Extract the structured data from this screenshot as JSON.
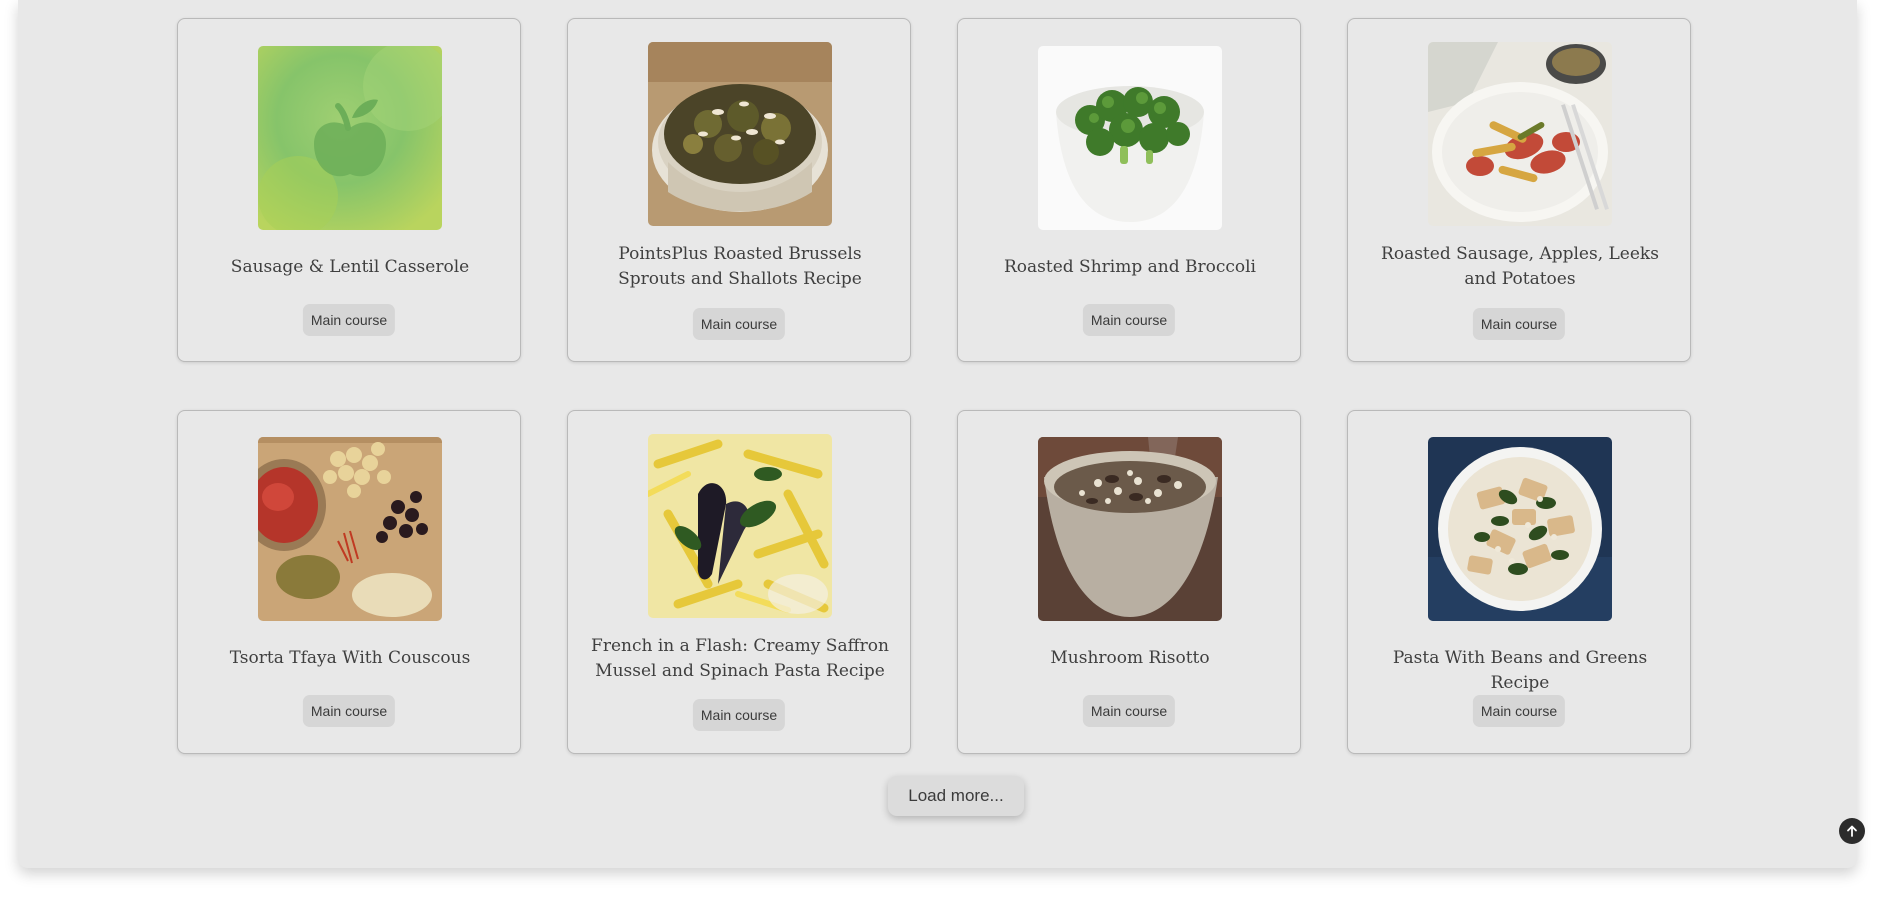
{
  "recipes": [
    {
      "title": "Sausage & Lentil Casserole",
      "category": "Main course",
      "image": "placeholder-apple-icon"
    },
    {
      "title": "PointsPlus Roasted Brussels Sprouts and Shallots Recipe",
      "category": "Main course",
      "image": "brussels-sprouts-photo"
    },
    {
      "title": "Roasted Shrimp and Broccoli",
      "category": "Main course",
      "image": "broccoli-bowl-photo"
    },
    {
      "title": "Roasted Sausage, Apples, Leeks and Potatoes",
      "category": "Main course",
      "image": "sausage-apples-plate-photo"
    },
    {
      "title": "Tsorta Tfaya With Couscous",
      "category": "Main course",
      "image": "spices-board-photo"
    },
    {
      "title": "French in a Flash: Creamy Saffron Mussel and Spinach Pasta Recipe",
      "category": "Main course",
      "image": "mussel-pasta-photo"
    },
    {
      "title": "Mushroom Risotto",
      "category": "Main course",
      "image": "risotto-bowl-photo"
    },
    {
      "title": "Pasta With Beans and Greens Recipe",
      "category": "Main course",
      "image": "pasta-greens-photo"
    }
  ],
  "load_more_label": "Load more...",
  "scroll_top_icon": "arrow-up-icon",
  "colors": {
    "panel": "#e8e8e8",
    "badge": "#d6d6d6",
    "button": "#dcdcdc",
    "scroll_top": "#2c2c2c"
  }
}
